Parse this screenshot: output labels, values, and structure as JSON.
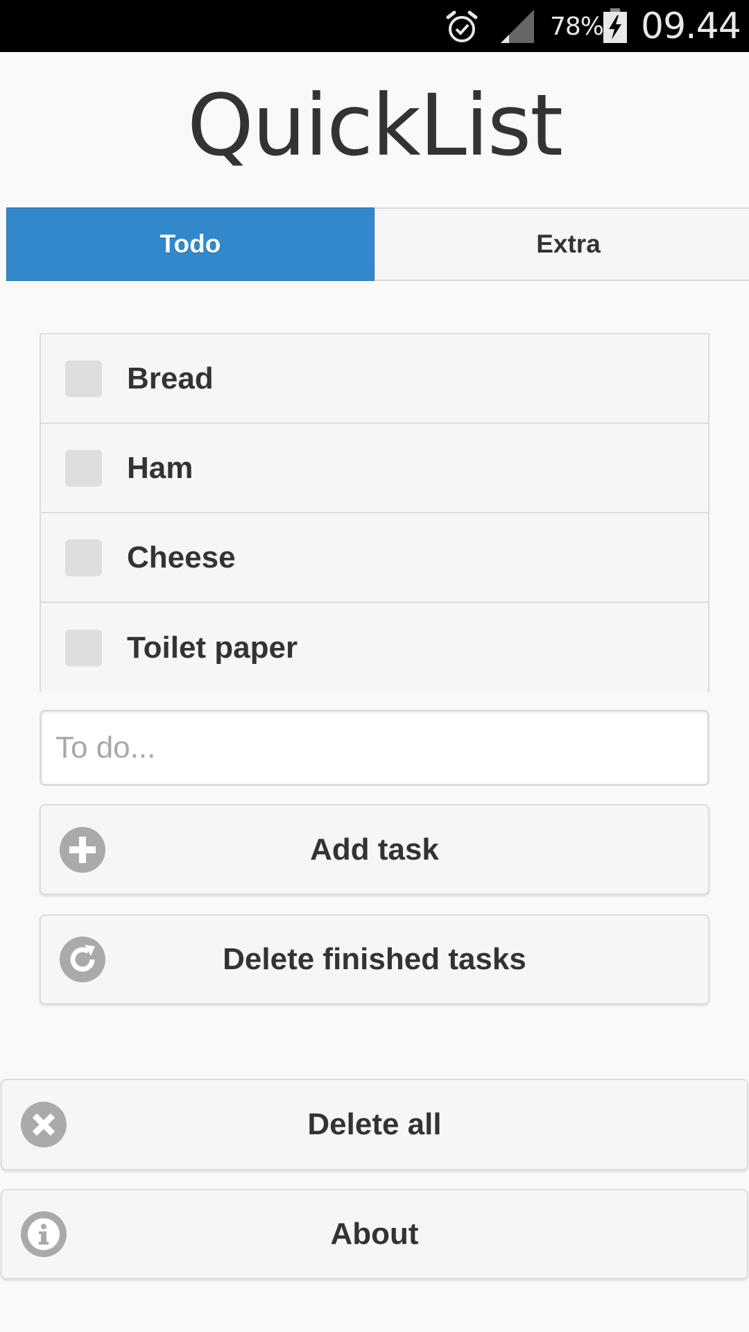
{
  "status_bar": {
    "battery_percent": "78%",
    "time": "09.44",
    "icons": [
      "alarm-icon",
      "signal-icon",
      "battery-charging-icon"
    ]
  },
  "header": {
    "title": "QuickList"
  },
  "tabs": [
    {
      "label": "Todo",
      "active": true
    },
    {
      "label": "Extra",
      "active": false
    }
  ],
  "tasks": [
    {
      "label": "Bread",
      "checked": false
    },
    {
      "label": "Ham",
      "checked": false
    },
    {
      "label": "Cheese",
      "checked": false
    },
    {
      "label": "Toilet paper",
      "checked": false
    }
  ],
  "input": {
    "placeholder": "To do...",
    "value": ""
  },
  "buttons": {
    "add_task": {
      "label": "Add task",
      "icon": "plus-icon"
    },
    "delete_finished": {
      "label": "Delete finished tasks",
      "icon": "refresh-icon"
    },
    "delete_all": {
      "label": "Delete all",
      "icon": "close-icon"
    },
    "about": {
      "label": "About",
      "icon": "info-icon"
    }
  },
  "colors": {
    "accent": "#3388cc",
    "background": "#f9f9f9",
    "icon_gray": "#aaaaaa",
    "text": "#333333"
  }
}
